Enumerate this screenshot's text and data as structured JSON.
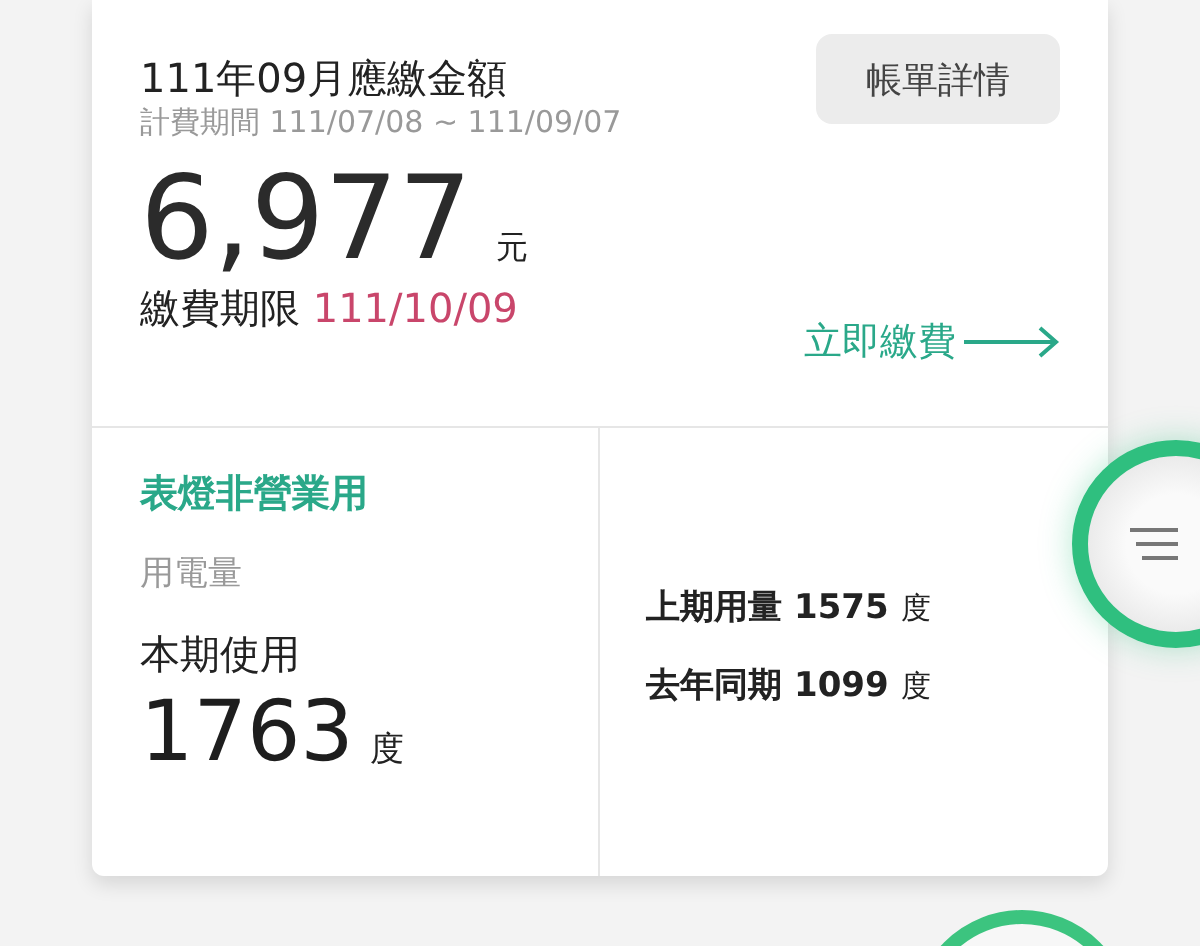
{
  "bill": {
    "title": "111年09月應繳金額",
    "period": "計費期間 111/07/08 ~ 111/09/07",
    "amount": "6,977",
    "amount_unit": "元",
    "deadline_label": "繳費期限",
    "deadline": "111/10/09",
    "detail_button": "帳單詳情",
    "pay_link": "立即繳費"
  },
  "usage": {
    "category": "表燈非營業用",
    "label": "用電量",
    "current_label": "本期使用",
    "current_value": "1763",
    "unit": "度",
    "comparisons": [
      {
        "label": "上期用量",
        "value": "1575",
        "unit": "度"
      },
      {
        "label": "去年同期",
        "value": "1099",
        "unit": "度"
      }
    ]
  }
}
